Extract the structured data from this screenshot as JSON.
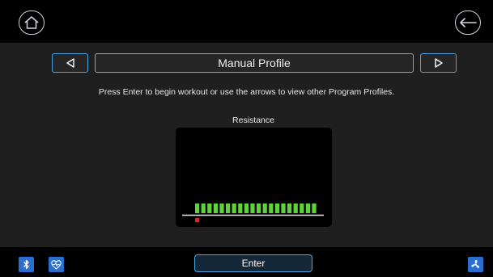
{
  "header": {
    "home_icon": "home-icon",
    "back_icon": "arrow-left-icon"
  },
  "profile_nav": {
    "prev_icon": "triangle-left-icon",
    "next_icon": "triangle-right-icon",
    "title": "Manual Profile"
  },
  "instruction": "Press Enter to begin workout or use the arrows to view other Program Profiles.",
  "chart": {
    "label": "Resistance",
    "bar_color": "#5fd33a",
    "marker_color": "#e0202a"
  },
  "chart_data": {
    "type": "bar",
    "title": "Resistance",
    "values": [
      1,
      1,
      1,
      1,
      1,
      1,
      1,
      1,
      1,
      1,
      1,
      1,
      1,
      1,
      1,
      1,
      1,
      1,
      1,
      1
    ],
    "current_segment": 1
  },
  "footer": {
    "bluetooth_icon": "bluetooth-icon",
    "heart_icon": "heart-rate-icon",
    "enter_label": "Enter",
    "fan_icon": "fan-icon",
    "accent": "#2a6fd0"
  }
}
